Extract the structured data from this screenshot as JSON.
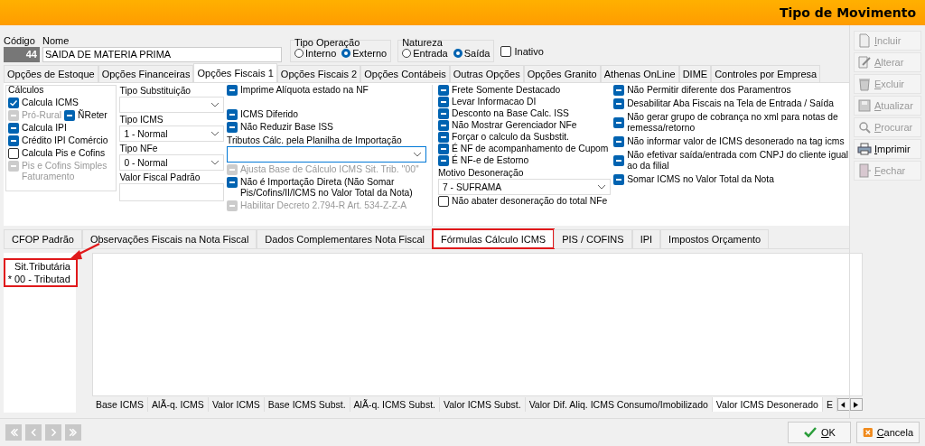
{
  "window": {
    "title": "Tipo de Movimento"
  },
  "header": {
    "codigo": {
      "label": "Código",
      "value": "44"
    },
    "nome": {
      "label": "Nome",
      "value": "SAIDA DE MATERIA PRIMA"
    },
    "tipo_operacao": {
      "label": "Tipo Operação",
      "options": [
        {
          "label": "Interno",
          "selected": false
        },
        {
          "label": "Externo",
          "selected": true
        }
      ]
    },
    "natureza": {
      "label": "Natureza",
      "options": [
        {
          "label": "Entrada",
          "selected": false
        },
        {
          "label": "Saída",
          "selected": true
        }
      ]
    },
    "inativo": {
      "label": "Inativo",
      "checked": false,
      "disabled": false
    }
  },
  "tabs": [
    {
      "label": "Opções de Estoque",
      "selected": false
    },
    {
      "label": "Opções Financeiras",
      "selected": false
    },
    {
      "label": "Opções Fiscais 1",
      "selected": true
    },
    {
      "label": "Opções Fiscais 2",
      "selected": false
    },
    {
      "label": "Opções Contábeis",
      "selected": false
    },
    {
      "label": "Outras Opções",
      "selected": false
    },
    {
      "label": "Opções Granito",
      "selected": false
    },
    {
      "label": "Athenas OnLine",
      "selected": false
    },
    {
      "label": "DIME",
      "selected": false
    },
    {
      "label": "Controles por Empresa",
      "selected": false
    }
  ],
  "calculos": {
    "title": "Cálculos",
    "rows": [
      [
        {
          "label": "Calcula ICMS",
          "checked": true,
          "disabled": false
        }
      ],
      [
        {
          "label": "Pró-Rural",
          "indeterminate": true,
          "disabled": true
        },
        {
          "label": "ÑReter",
          "indeterminate": true,
          "disabled": false
        }
      ],
      [
        {
          "label": "Calcula IPI",
          "indeterminate": true,
          "disabled": false
        }
      ],
      [
        {
          "label": "Crédito IPI Comércio",
          "indeterminate": true,
          "disabled": false
        }
      ],
      [
        {
          "label": "Calcula Pis e Cofins",
          "checked": false,
          "disabled": false
        }
      ],
      [
        {
          "label": "Pis e Cofins Simples Faturamento",
          "indeterminate": true,
          "disabled": true
        }
      ]
    ]
  },
  "fields": [
    {
      "label": "Tipo Substituição",
      "kind": "select"
    },
    {
      "label": "Tipo ICMS",
      "kind": "select",
      "value": "1 - Normal"
    },
    {
      "label": "Tipo NFe",
      "kind": "select",
      "value": "0 - Normal"
    },
    {
      "label": "Valor Fiscal Padrão",
      "kind": "text"
    }
  ],
  "column_3": [
    {
      "kind": "checkbox",
      "label": "Imprime Alíquota estado na NF",
      "indeterminate": true,
      "disabled": false
    },
    {
      "kind": "spacer"
    },
    {
      "kind": "checkbox",
      "label": "ICMS Diferido",
      "indeterminate": true,
      "disabled": false
    },
    {
      "kind": "checkbox",
      "label": "Não Reduzir Base ISS",
      "indeterminate": true,
      "disabled": false
    },
    {
      "kind": "select",
      "label": "Tributos Cálc. pela Planilha de Importação",
      "focused": true
    },
    {
      "kind": "checkbox",
      "label": "Ajusta Base de Cálculo ICMS Sit. Trib. ''00''",
      "indeterminate": true,
      "disabled": true
    },
    {
      "kind": "checkbox",
      "label": "Não é Importação Direta (Não Somar Pis/Cofins/II/ICMS  no Valor Total da Nota)",
      "indeterminate": true,
      "disabled": false
    },
    {
      "kind": "checkbox",
      "label": "Habilitar Decreto 2.794-R Art. 534-Z-Z-A",
      "indeterminate": true,
      "disabled": true
    }
  ],
  "column_4": [
    {
      "kind": "checkbox",
      "label": "Frete Somente Destacado",
      "indeterminate": true,
      "disabled": false
    },
    {
      "kind": "checkbox",
      "label": "Levar Informacao DI",
      "indeterminate": true,
      "disabled": false
    },
    {
      "kind": "checkbox",
      "label": "Desconto na Base Calc. ISS",
      "indeterminate": true,
      "disabled": false
    },
    {
      "kind": "checkbox",
      "label": "Não Mostrar Gerenciador NFe",
      "indeterminate": true,
      "disabled": false
    },
    {
      "kind": "checkbox",
      "label": "Forçar o calculo da Susbstit.",
      "indeterminate": true,
      "disabled": false
    },
    {
      "kind": "checkbox",
      "label": "É NF de acompanhamento de Cupom",
      "indeterminate": true,
      "disabled": false
    },
    {
      "kind": "checkbox",
      "label": "É NF-e de Estorno",
      "indeterminate": true,
      "disabled": false
    },
    {
      "kind": "select",
      "label": "Motivo Desoneração",
      "value": "7 - SUFRAMA",
      "focused": false
    },
    {
      "kind": "checkbox",
      "label": "Não abater desoneração do total NFe",
      "checked": false,
      "disabled": false
    }
  ],
  "column_5": [
    {
      "kind": "checkbox",
      "label": "Não Permitir diferente dos Paramentros",
      "indeterminate": true,
      "disabled": false
    },
    {
      "kind": "checkbox",
      "label": "Desabilitar Aba Fiscais na Tela de Entrada / Saída",
      "indeterminate": true,
      "disabled": false
    },
    {
      "kind": "checkbox",
      "label": "Não gerar grupo de cobrança no xml para notas de remessa/retorno",
      "indeterminate": true,
      "disabled": false
    },
    {
      "kind": "checkbox",
      "label": "Não informar valor de ICMS desonerado na tag icms",
      "indeterminate": true,
      "disabled": false
    },
    {
      "kind": "checkbox",
      "label": "Não efetivar saída/entrada com CNPJ do cliente igual ao da filial",
      "indeterminate": true,
      "disabled": false
    },
    {
      "kind": "checkbox",
      "label": "Somar ICMS no Valor Total da Nota",
      "indeterminate": true,
      "disabled": false
    }
  ],
  "lower_tabs": [
    {
      "label": "CFOP Padrão",
      "selected": false,
      "highlighted": false
    },
    {
      "label": "Observações Fiscais na Nota Fiscal",
      "selected": false,
      "highlighted": false
    },
    {
      "label": "Dados Complementares Nota Fiscal",
      "selected": false,
      "highlighted": false
    },
    {
      "label": "Fórmulas Cálculo ICMS",
      "selected": true,
      "highlighted": true
    },
    {
      "label": "PIS / COFINS",
      "selected": false,
      "highlighted": false
    },
    {
      "label": "IPI",
      "selected": false,
      "highlighted": false
    },
    {
      "label": "Impostos Orçamento",
      "selected": false,
      "highlighted": false
    }
  ],
  "grid": {
    "highlighted": true,
    "header": "Sit.Tributária",
    "rows": [
      {
        "marker": "*",
        "value": "00 - Tributad"
      }
    ]
  },
  "column_tabs": [
    {
      "label": "Base ICMS",
      "selected": false
    },
    {
      "label": "AlÃ-q. ICMS",
      "selected": false
    },
    {
      "label": "Valor ICMS",
      "selected": false
    },
    {
      "label": "Base ICMS Subst.",
      "selected": false
    },
    {
      "label": "AlÃ-q. ICMS Subst.",
      "selected": false
    },
    {
      "label": "Valor ICMS Subst.",
      "selected": false
    },
    {
      "label": "Valor Dif. Aliq. ICMS Consumo/Imobilizado",
      "selected": false
    },
    {
      "label": "Valor ICMS Desonerado",
      "selected": true
    },
    {
      "label": "E",
      "selected": false
    }
  ],
  "toolbar": [
    {
      "label": "Incluir",
      "disabled": true
    },
    {
      "label": "Alterar",
      "disabled": true
    },
    {
      "label": "Excluir",
      "disabled": true
    },
    {
      "label": "Atualizar",
      "disabled": true
    },
    {
      "label": "Procurar",
      "disabled": true
    },
    {
      "label": "Imprimir",
      "disabled": false
    },
    {
      "label": "Fechar",
      "disabled": true
    }
  ],
  "navigation": [
    {
      "kind": "first",
      "disabled": true
    },
    {
      "kind": "prev",
      "disabled": true
    },
    {
      "kind": "next",
      "disabled": true
    },
    {
      "kind": "last",
      "disabled": true
    }
  ],
  "footer_buttons": [
    {
      "label": "OK",
      "kind": "ok"
    },
    {
      "label": "Cancela",
      "kind": "cancel"
    }
  ]
}
